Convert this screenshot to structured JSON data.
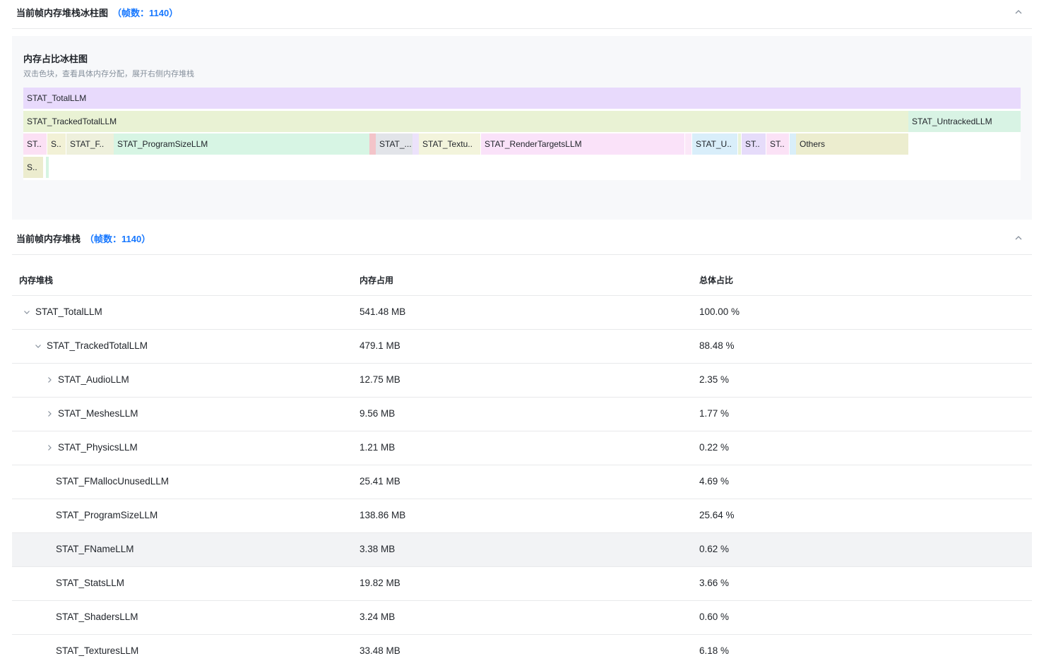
{
  "flame_section": {
    "title": "当前帧内存堆栈冰柱图",
    "count": "（帧数：1140）",
    "panel_title": "内存占比冰柱图",
    "panel_subtitle": "双击色块，查看具体内存分配，展开右侧内存堆栈",
    "rows": [
      [
        {
          "label": "STAT_TotalLLM",
          "color": "#e8dafc"
        }
      ],
      [
        {
          "label": "STAT_TrackedTotalLLM",
          "color": "#e9f2d4"
        },
        {
          "label": "STAT_UntrackedLLM",
          "color": "#d8f3e4"
        }
      ],
      [
        {
          "label": "ST..",
          "color": "#fbe0f4"
        },
        {
          "label": "S..",
          "color": "#f2f1d6"
        },
        {
          "label": "STAT_F..",
          "color": "#eef0dc"
        },
        {
          "label": "STAT_ProgramSizeLLM",
          "color": "#d7f5e4"
        },
        {
          "label": "",
          "color": "#f3c4c9"
        },
        {
          "label": "STAT_...",
          "color": "#e2e4e9"
        },
        {
          "label": "",
          "color": "#ece2fb"
        },
        {
          "label": "STAT_Textu..",
          "color": "#f3f4dc"
        },
        {
          "label": "STAT_RenderTargetsLLM",
          "color": "#fae2f9"
        },
        {
          "label": "",
          "color": "#fbe7f8"
        },
        {
          "label": "STAT_U..",
          "color": "#d9eefa"
        },
        {
          "label": "",
          "color": "#e8f2d8"
        },
        {
          "label": "ST..",
          "color": "#e6dcfa"
        },
        {
          "label": "ST..",
          "color": "#fbe2f6"
        },
        {
          "label": "",
          "color": "#d9eef9"
        },
        {
          "label": "Others",
          "color": "#ecedcf"
        }
      ],
      [
        {
          "label": "S..",
          "color": "#ececce"
        },
        {
          "label": "",
          "color": "#d6f4e2"
        }
      ]
    ]
  },
  "stack_section": {
    "title": "当前帧内存堆栈",
    "count": "（帧数：1140）",
    "columns": [
      "内存堆栈",
      "内存占用",
      "总体占比"
    ],
    "rows": [
      {
        "name": "STAT_TotalLLM",
        "size": "541.48 MB",
        "pct": "100.00 %",
        "arrow": "expanded"
      },
      {
        "name": "STAT_TrackedTotalLLM",
        "size": "479.1 MB",
        "pct": "88.48 %",
        "arrow": "expanded"
      },
      {
        "name": "STAT_AudioLLM",
        "size": "12.75 MB",
        "pct": "2.35 %",
        "arrow": "collapsed"
      },
      {
        "name": "STAT_MeshesLLM",
        "size": "9.56 MB",
        "pct": "1.77 %",
        "arrow": "collapsed"
      },
      {
        "name": "STAT_PhysicsLLM",
        "size": "1.21 MB",
        "pct": "0.22 %",
        "arrow": "collapsed"
      },
      {
        "name": "STAT_FMallocUnusedLLM",
        "size": "25.41 MB",
        "pct": "4.69 %",
        "arrow": "none"
      },
      {
        "name": "STAT_ProgramSizeLLM",
        "size": "138.86 MB",
        "pct": "25.64 %",
        "arrow": "none"
      },
      {
        "name": "STAT_FNameLLM",
        "size": "3.38 MB",
        "pct": "0.62 %",
        "arrow": "none",
        "highlighted": true
      },
      {
        "name": "STAT_StatsLLM",
        "size": "19.82 MB",
        "pct": "3.66 %",
        "arrow": "none"
      },
      {
        "name": "STAT_ShadersLLM",
        "size": "3.24 MB",
        "pct": "0.60 %",
        "arrow": "none"
      },
      {
        "name": "STAT_TexturesLLM",
        "size": "33.48 MB",
        "pct": "6.18 %",
        "arrow": "none"
      }
    ]
  },
  "icons": {
    "toolbar": [
      "refresh-icon",
      "download-icon",
      "crop-icon",
      "reset-zoom-icon"
    ],
    "collapse": "chevron-up-icon"
  }
}
